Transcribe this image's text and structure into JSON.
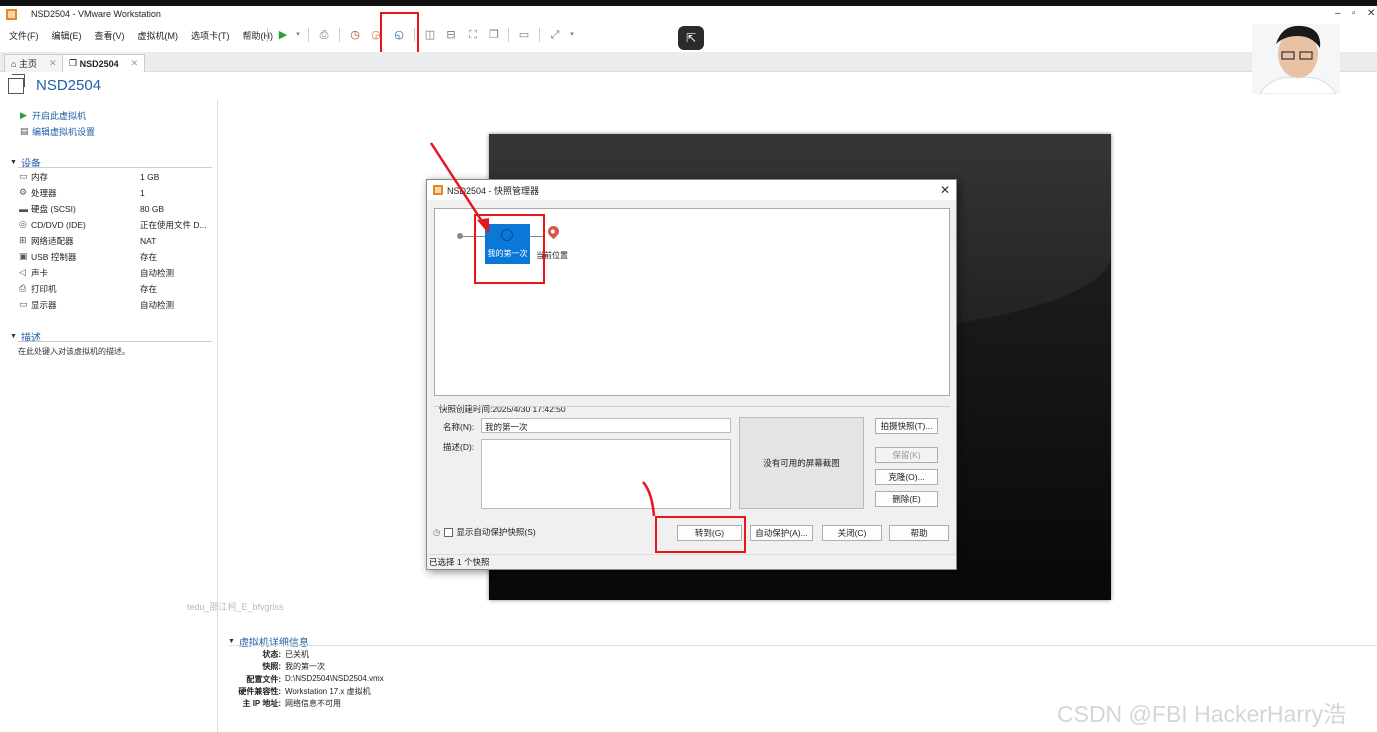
{
  "window": {
    "title": "NSD2504 - VMware Workstation"
  },
  "menu": [
    "文件(F)",
    "编辑(E)",
    "查看(V)",
    "虚拟机(M)",
    "选项卡(T)",
    "帮助(H)"
  ],
  "tabs": {
    "home": "主页",
    "vm": "NSD2504"
  },
  "vm": {
    "name": "NSD2504",
    "actions": {
      "power_on": "开启此虚拟机",
      "edit_settings": "编辑虚拟机设置"
    }
  },
  "devices": {
    "section": "设备",
    "items": [
      {
        "name": "内存",
        "value": "1 GB",
        "icon": "memory-icon"
      },
      {
        "name": "处理器",
        "value": "1",
        "icon": "cpu-icon"
      },
      {
        "name": "硬盘 (SCSI)",
        "value": "80 GB",
        "icon": "disk-icon"
      },
      {
        "name": "CD/DVD (IDE)",
        "value": "正在使用文件 D...",
        "icon": "cd-icon"
      },
      {
        "name": "网络适配器",
        "value": "NAT",
        "icon": "network-icon"
      },
      {
        "name": "USB 控制器",
        "value": "存在",
        "icon": "usb-icon"
      },
      {
        "name": "声卡",
        "value": "自动检测",
        "icon": "sound-icon"
      },
      {
        "name": "打印机",
        "value": "存在",
        "icon": "printer-icon"
      },
      {
        "name": "显示器",
        "value": "自动检测",
        "icon": "monitor-icon"
      }
    ]
  },
  "description": {
    "section": "描述",
    "placeholder": "在此处键入对该虚拟机的描述。"
  },
  "dialog": {
    "title": "NSD2504 - 快照管理器",
    "snapshot_node": "我的第一次",
    "current_position": "当前位置",
    "created_time": "快照创建时间:2025/4/30 17:42:50",
    "name_label": "名称(N):",
    "name_value": "我的第一次",
    "desc_label": "描述(D):",
    "no_screenshot": "没有可用的屏幕截图",
    "buttons": {
      "take_snapshot": "拍摄快照(T)...",
      "keep": "保留(K)",
      "clone": "克隆(O)...",
      "delete": "删除(E)",
      "goto": "转到(G)",
      "autoprotect": "自动保护(A)...",
      "close": "关闭(C)",
      "help": "帮助"
    },
    "show_autoprotect": "显示自动保护快照(S)",
    "status": "已选择 1 个快照"
  },
  "details": {
    "section": "虚拟机详细信息",
    "rows": [
      {
        "k": "状态:",
        "v": "已关机"
      },
      {
        "k": "快照:",
        "v": "我的第一次"
      },
      {
        "k": "配置文件:",
        "v": "D:\\NSD2504\\NSD2504.vmx"
      },
      {
        "k": "硬件兼容性:",
        "v": "Workstation 17.x 虚拟机"
      },
      {
        "k": "主 IP 地址:",
        "v": "网络信息不可用"
      }
    ]
  },
  "watermark": "tedu_邵江柯_E_bfvgriss",
  "csdn": "CSDN @FBI HackerHarry浩",
  "colors": {
    "accent": "#1f5fa8",
    "highlight_red": "#e8151b",
    "selected_node": "#0a78d7"
  }
}
